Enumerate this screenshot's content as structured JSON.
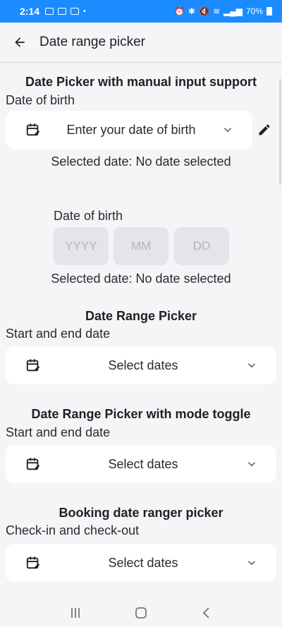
{
  "status_bar": {
    "time": "2:14",
    "battery": "70%"
  },
  "app_bar": {
    "title": "Date range picker"
  },
  "manual": {
    "title": "Date Picker with manual input support",
    "label": "Date of birth",
    "placeholder": "Enter your date of birth",
    "selected": "Selected date: No date selected"
  },
  "segmented": {
    "label": "Date of birth",
    "year": "YYYY",
    "month": "MM",
    "day": "DD",
    "selected": "Selected date: No date selected"
  },
  "range": {
    "title": "Date Range Picker",
    "label": "Start and end date",
    "value": "Select dates"
  },
  "range_toggle": {
    "title": "Date Range Picker with mode toggle",
    "label": "Start and end date",
    "value": "Select dates"
  },
  "booking": {
    "title": "Booking date ranger picker",
    "label": "Check-in and check-out",
    "value": "Select dates"
  },
  "icons": {
    "back": "arrow-back-icon",
    "calendar": "calendar-edit-icon",
    "chevron": "chevron-down-icon",
    "edit": "pencil-icon",
    "nav_recents": "recents-icon",
    "nav_home": "home-icon",
    "nav_back": "back-icon"
  },
  "colors": {
    "status_bar": "#1a8cff",
    "background": "#f5f4f7",
    "card": "#ffffff",
    "segment": "#e5e4e9"
  }
}
